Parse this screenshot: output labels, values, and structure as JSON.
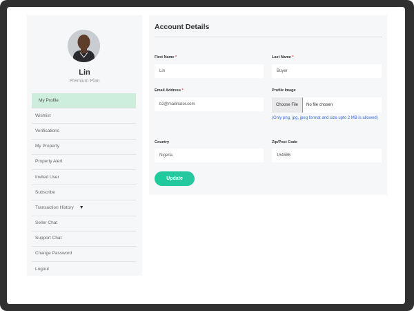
{
  "profile": {
    "name": "Lin",
    "plan": "Premium Plan"
  },
  "sidebar": {
    "items": [
      {
        "label": "My Profile"
      },
      {
        "label": "Wishlist"
      },
      {
        "label": "Verifications"
      },
      {
        "label": "My Property"
      },
      {
        "label": "Property Alert"
      },
      {
        "label": "Invited User"
      },
      {
        "label": "Subscribe"
      },
      {
        "label": "Transaction History"
      },
      {
        "label": "Seller Chat"
      },
      {
        "label": "Support Chat"
      },
      {
        "label": "Change Password"
      },
      {
        "label": "Logout"
      }
    ]
  },
  "form": {
    "title": "Account Details",
    "first_name": {
      "label": "First Name",
      "value": "Lin"
    },
    "last_name": {
      "label": "Last Name",
      "value": "Buyer"
    },
    "email": {
      "label": "Email Address",
      "value": "b2@mailinator.com"
    },
    "profile_image": {
      "label": "Profile Image",
      "button": "Choose File",
      "status": "No file chosen",
      "hint": "(Only png, jpg, jpeg format and size upto 2 MB is allowed)"
    },
    "country": {
      "label": "Country",
      "value": "Nigeria"
    },
    "zip": {
      "label": "Zip/Post Code",
      "value": "154686"
    },
    "required_mark": "*",
    "submit_label": "Update"
  },
  "colors": {
    "active_menu": "#cdeedd",
    "accent": "#1ecb9b",
    "hint": "#3a6fd8",
    "required": "#e53935"
  }
}
